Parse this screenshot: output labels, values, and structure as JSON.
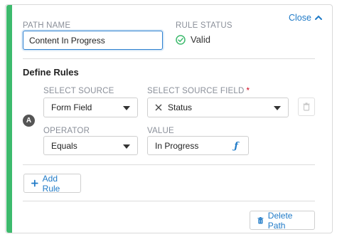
{
  "header": {
    "close_label": "Close",
    "path_name_label": "PATH NAME",
    "path_name_value": "Content In Progress",
    "rule_status_label": "RULE STATUS",
    "rule_status_value": "Valid"
  },
  "rules": {
    "section_title": "Define Rules",
    "items": [
      {
        "badge": "A",
        "select_source_label": "SELECT SOURCE",
        "select_source_value": "Form Field",
        "select_source_field_label": "SELECT SOURCE FIELD",
        "select_source_field_required": "*",
        "select_source_field_value": "Status",
        "operator_label": "OPERATOR",
        "operator_value": "Equals",
        "value_label": "VALUE",
        "value_value": "In Progress"
      }
    ],
    "add_rule_label": "Add Rule"
  },
  "footer": {
    "delete_path_label": "Delete Path"
  },
  "colors": {
    "accent": "#3dba6d",
    "link": "#1f7ac7",
    "valid": "#3dba6d"
  },
  "icons": {
    "close": "chevron-up-icon",
    "valid": "check-circle-icon",
    "clear": "x-icon",
    "delete_rule": "trash-icon",
    "formula": "function-icon",
    "add": "plus-icon",
    "delete_path": "trash-icon"
  }
}
